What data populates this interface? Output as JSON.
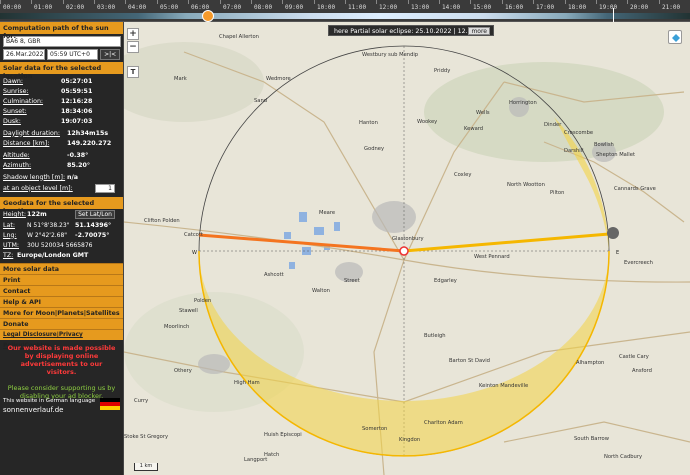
{
  "timeline": {
    "ticks": [
      "00:00",
      "01:00",
      "02:00",
      "03:00",
      "04:00",
      "05:00",
      "06:00",
      "07:00",
      "08:00",
      "09:00",
      "10:00",
      "11:00",
      "12:00",
      "13:00",
      "14:00",
      "15:00",
      "16:00",
      "17:00",
      "18:00",
      "19:00",
      "20:00",
      "21:00"
    ]
  },
  "sidebar": {
    "computation_title": "Computation path of the sun for:",
    "location_value": "BA6 8, GBR",
    "date_value": "26.Mar.2022",
    "time_value": "05:59 UTC+0",
    "nav_button": ">|<",
    "solar_title": "Solar data for the selected location",
    "solar_rows": [
      {
        "label": "Dawn:",
        "value": "05:27:01"
      },
      {
        "label": "Sunrise:",
        "value": "05:59:51"
      },
      {
        "label": "Culmination:",
        "value": "12:16:28"
      },
      {
        "label": "Sunset:",
        "value": "18:34:06"
      },
      {
        "label": "Dusk:",
        "value": "19:07:03"
      },
      {
        "label": "Daylight duration:",
        "value": "12h34m15s"
      },
      {
        "label": "Distance [km]:",
        "value": "149.220.272"
      },
      {
        "label": "Altitude:",
        "value": "-0.38°"
      },
      {
        "label": "Azimuth:",
        "value": "85.20°"
      },
      {
        "label": "Shadow length [m]:",
        "value": "n/a"
      }
    ],
    "object_level_label": "at an object level [m]:",
    "object_level_value": "1",
    "geodata_title": "Geodata for the selected location",
    "height_label": "Height:",
    "height_value": "122m",
    "set_latlon_button": "Set Lat/Lon",
    "lat_label": "Lat:",
    "lat_dms": "N 51°8'38.23\"",
    "lat_dec": "51.14396°",
    "lng_label": "Lng:",
    "lng_dms": "W 2°42'2.68\"",
    "lng_dec": "-2.70075°",
    "utm_label": "UTM:",
    "utm_value": "30U 520034 5665876",
    "tz_label": "TZ:",
    "tz_value": "Europe/London  GMT",
    "menu_items": [
      "More solar data",
      "Print",
      "Contact",
      "Help & API",
      "More for Moon|Planets|Satellites",
      "Donate",
      "Legal Disclosure|Privacy Policy|Cookies"
    ],
    "red_message": "Our website is made possible by displaying online advertisements to our visitors.",
    "green_message": "Please consider supporting us by disabling your ad blocker.",
    "german_note": "This website in German language",
    "site_name": "sonnenverlauf.de"
  },
  "map": {
    "eclipse_text": "here Partial solar eclipse: 25.10.2022 | 12.1%",
    "more_button": "more",
    "zoom_in": "+",
    "zoom_out": "−",
    "tool_button": "T",
    "scale_label": "1 km",
    "places": [
      "Chapel Allerton",
      "Westbury sub Mendip",
      "Mark",
      "Wedmore",
      "Priddy",
      "Sand",
      "Wookey",
      "Horrington",
      "Wells",
      "Dinder",
      "Croscombe",
      "Hanton",
      "Keward",
      "Darshill",
      "Bowlish",
      "Shepton Mallet",
      "Godney",
      "Coxley",
      "Pilton",
      "North Wootton",
      "Meare",
      "Glastonbury",
      "Cannards Grave",
      "Clifton Polden",
      "Catcott",
      "Edgarley",
      "West Pennard",
      "Evercreech",
      "Ashcott",
      "Street",
      "Walton",
      "Butleigh",
      "Moorlinch",
      "Stawell",
      "Othery",
      "High Ham",
      "Keinton Mandeville",
      "Barton St David",
      "Castle Cary",
      "Ansford",
      "Alhampton",
      "Somerton",
      "Charlton Adam",
      "Kingdon",
      "Stoke St Gregory",
      "Huish Episcopi",
      "Langport",
      "South Barrow",
      "North Cadbury",
      "Curry",
      "Polden",
      "Hatch"
    ],
    "colors": {
      "sun_rise_line": "#f4741f",
      "sun_path_line": "#f5b700",
      "shadow_area": "#f3d346"
    }
  }
}
